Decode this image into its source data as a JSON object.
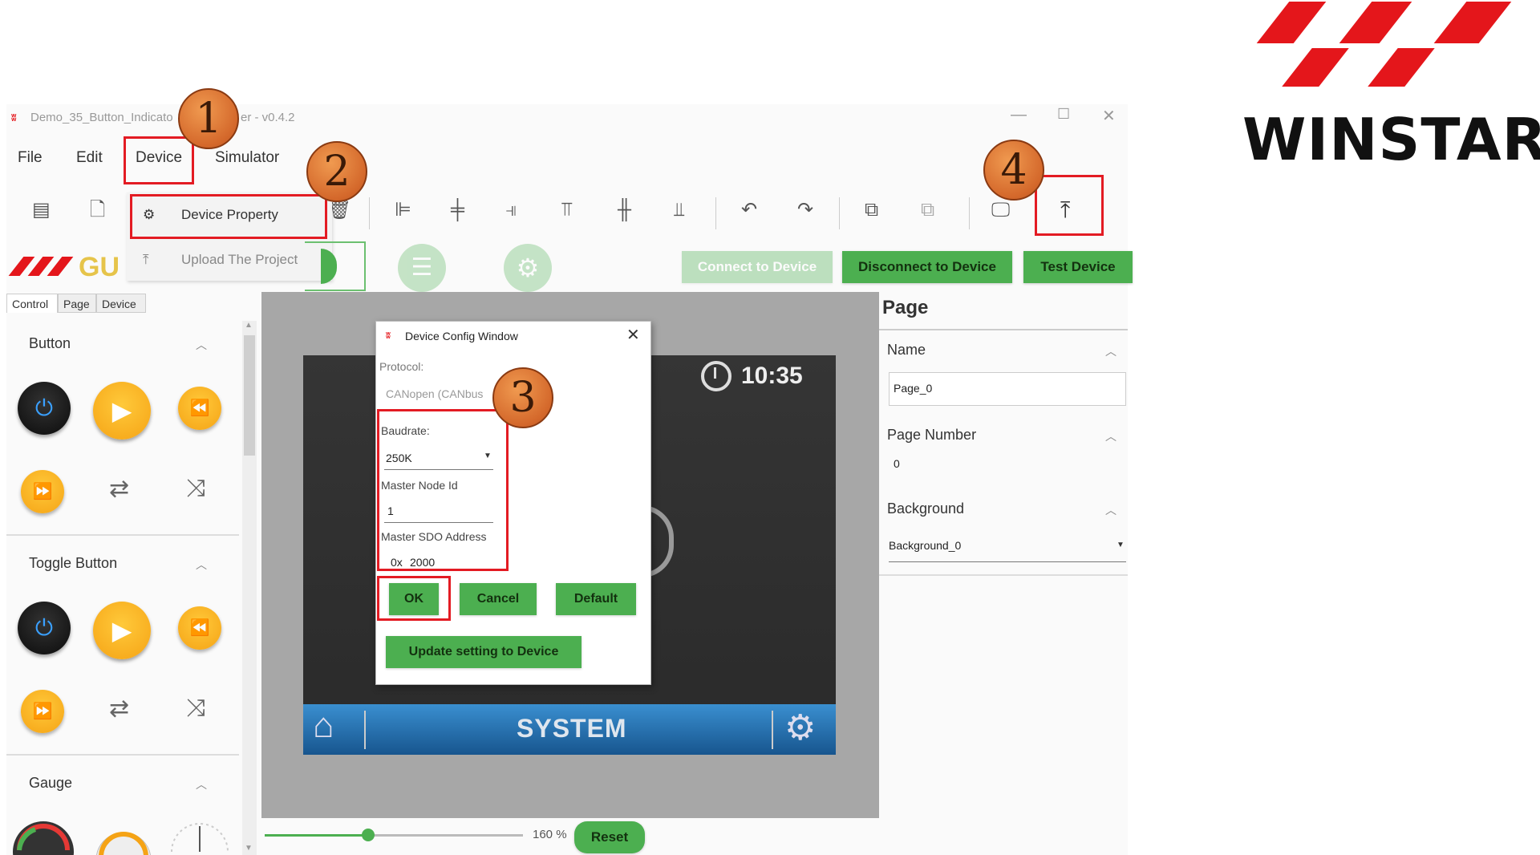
{
  "brand": {
    "logo_text": "WINSTAR",
    "red": "#e4161b"
  },
  "window": {
    "title": "Demo_35_Button_Indicator — GUI Builder - v0.4.2",
    "title_visible": "Demo_35_Button_Indicato",
    "title_visible_tail": "er - v0.4.2",
    "controls": {
      "minimize": "—",
      "maximize": "☐",
      "close": "✕"
    }
  },
  "menu": {
    "file": "File",
    "edit": "Edit",
    "device": "Device",
    "simulator": "Simulator"
  },
  "dropdown": {
    "device_property": "Device Property",
    "upload_project": "Upload The Project"
  },
  "badges": {
    "one": "1",
    "two": "2",
    "three": "3",
    "four": "4"
  },
  "app_logo": {
    "text": "GU"
  },
  "actions": {
    "connect": "Connect to Device",
    "disconnect": "Disconnect to Device",
    "test": "Test Device"
  },
  "left_tabs": {
    "control": "Control",
    "page": "Page",
    "device": "Device"
  },
  "left_sections": {
    "button": "Button",
    "toggle_button": "Toggle Button",
    "gauge": "Gauge"
  },
  "screen": {
    "clock": "10:35",
    "system_label": "SYSTEM"
  },
  "dialog": {
    "title": "Device Config Window",
    "protocol_label": "Protocol:",
    "protocol_value": "CANopen (CANbus",
    "baudrate_label": "Baudrate:",
    "baudrate_value": "250K",
    "master_node_label": "Master Node Id",
    "master_node_value": "1",
    "sdo_label": "Master SDO Address",
    "sdo_prefix": "0x",
    "sdo_value": "2000",
    "ok": "OK",
    "cancel": "Cancel",
    "default": "Default",
    "update": "Update setting to Device"
  },
  "right_panel": {
    "header": "Page",
    "name_label": "Name",
    "name_value": "Page_0",
    "page_number_label": "Page Number",
    "page_number_value": "0",
    "background_label": "Background",
    "background_value": "Background_0"
  },
  "zoom": {
    "percent": "160 %",
    "level": 0.4,
    "reset": "Reset"
  }
}
